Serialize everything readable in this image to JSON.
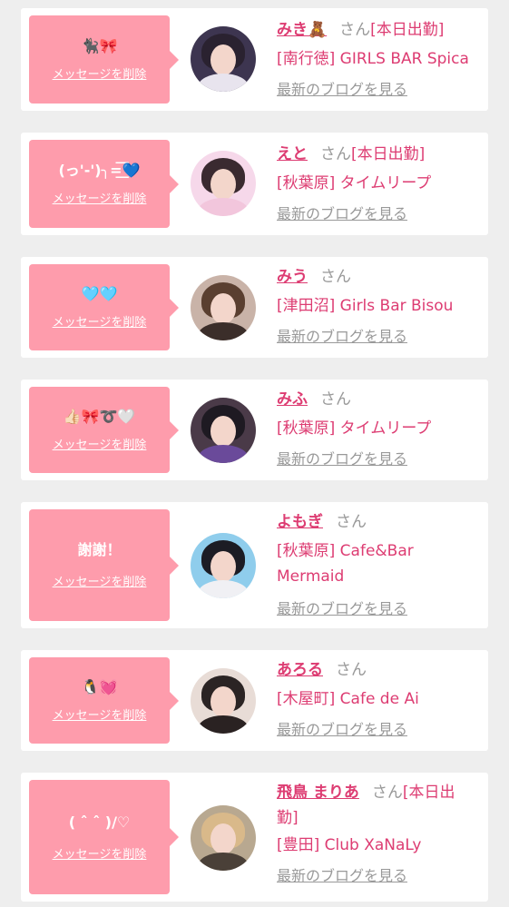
{
  "delete_label": "メッセージを削除",
  "blog_label": "最新のブログを見る",
  "san_label": "さん",
  "cards": [
    {
      "message": "🐈‍⬛🎀",
      "name": "みき🧸",
      "badge": "[本日出勤]",
      "shop": "[南行徳] GIRLS BAR Spica"
    },
    {
      "message": "(っ'-')╮=͟͟͞͞💙",
      "name": "えと",
      "badge": "[本日出勤]",
      "shop": "[秋葉原] タイムリープ"
    },
    {
      "message": "🩵🩵",
      "name": "みう",
      "badge": "",
      "shop": "[津田沼] Girls Bar Bisou"
    },
    {
      "message": "👍🏻🎀➰🤍",
      "name": "みふ",
      "badge": "",
      "shop": "[秋葉原] タイムリープ"
    },
    {
      "message": "謝謝！",
      "name": "よもぎ",
      "badge": "",
      "shop": "[秋葉原] Cafe&Bar Mermaid"
    },
    {
      "message": "🐧💓",
      "name": "あろる",
      "badge": "",
      "shop": "[木屋町] Cafe de Ai"
    },
    {
      "message": "( ˆ ˆ )/♡",
      "name": "飛鳥 まりあ",
      "badge": "[本日出勤]",
      "shop": "[豊田] Club XaNaLy"
    }
  ],
  "colors": {
    "accent": "#fe9cac",
    "name": "#dd3c72",
    "muted": "#999999",
    "background": "#eeeeee",
    "card": "#ffffff"
  }
}
